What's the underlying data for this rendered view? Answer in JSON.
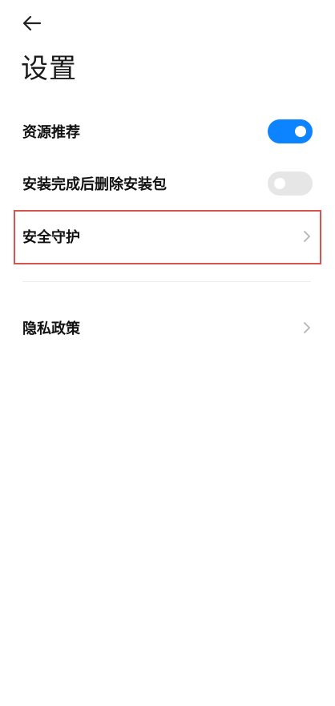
{
  "header": {
    "title": "设置"
  },
  "settings": {
    "resource_recommend": {
      "label": "资源推荐",
      "enabled": true
    },
    "delete_package": {
      "label": "安装完成后删除安装包",
      "enabled": false
    },
    "security": {
      "label": "安全守护"
    },
    "privacy": {
      "label": "隐私政策"
    }
  },
  "colors": {
    "accent": "#0d84ff",
    "toggle_off": "#e6e6e6",
    "highlight_border": "#d9534f"
  },
  "icons": {
    "back": "back-arrow-icon",
    "chevron": "chevron-right-icon"
  }
}
